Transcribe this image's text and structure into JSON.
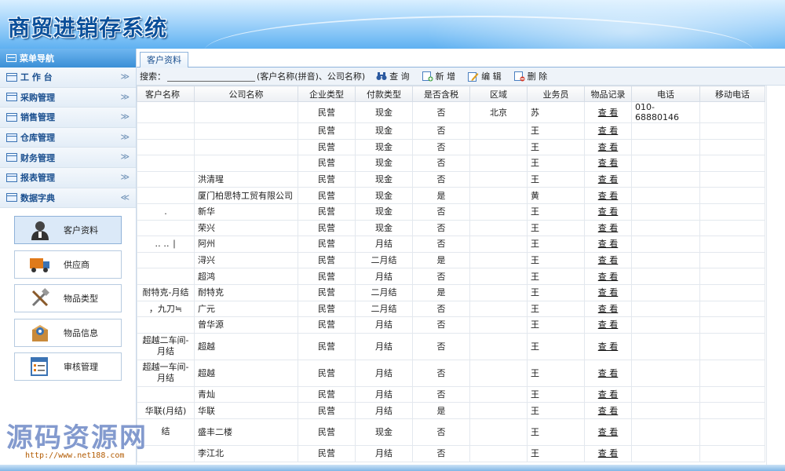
{
  "header": {
    "title": "商贸进销存系统"
  },
  "sidebar": {
    "heading": "菜单导航",
    "menu": [
      {
        "label": "工 作 台",
        "chev": "≫"
      },
      {
        "label": "采购管理",
        "chev": "≫"
      },
      {
        "label": "销售管理",
        "chev": "≫"
      },
      {
        "label": "仓库管理",
        "chev": "≫"
      },
      {
        "label": "财务管理",
        "chev": "≫"
      },
      {
        "label": "报表管理",
        "chev": "≫"
      },
      {
        "label": "数据字典",
        "chev": "≪"
      }
    ],
    "subitems": [
      {
        "label": "客户资料",
        "icon": "user-icon"
      },
      {
        "label": "供应商",
        "icon": "truck-icon"
      },
      {
        "label": "物品类型",
        "icon": "tools-icon"
      },
      {
        "label": "物品信息",
        "icon": "package-icon"
      },
      {
        "label": "审核管理",
        "icon": "form-icon"
      }
    ]
  },
  "tab": {
    "label": "客户资料"
  },
  "toolbar": {
    "search_label": "搜索：",
    "search_value": "",
    "hint": "(客户名称(拼音)、公司名称)",
    "query": "查 询",
    "add": "新 增",
    "edit": "编 辑",
    "delete": "删 除"
  },
  "columns": [
    "客户名称",
    "公司名称",
    "企业类型",
    "付款类型",
    "是否含税",
    "区域",
    "业务员",
    "物品记录",
    "电话",
    "移动电话"
  ],
  "rows": [
    [
      "",
      "",
      "民营",
      "现金",
      "否",
      "北京",
      "苏",
      "查 看",
      "010-68880146",
      ""
    ],
    [
      "",
      "",
      "民营",
      "现金",
      "否",
      "",
      "王",
      "查 看",
      "",
      ""
    ],
    [
      "",
      "",
      "民营",
      "现金",
      "否",
      "",
      "王",
      "查 看",
      "",
      ""
    ],
    [
      "",
      "",
      "民营",
      "现金",
      "否",
      "",
      "王",
      "查 看",
      "",
      ""
    ],
    [
      "",
      "洪清瑆",
      "民营",
      "现金",
      "否",
      "",
      "王",
      "查 看",
      "",
      ""
    ],
    [
      "",
      "厦门柏思特工贸有限公司",
      "民营",
      "现金",
      "是",
      "",
      "黄",
      "查 看",
      "",
      ""
    ],
    [
      ".",
      "新华",
      "民营",
      "现金",
      "否",
      "",
      "王",
      "查 看",
      "",
      ""
    ],
    [
      "",
      "荣兴",
      "民营",
      "现金",
      "否",
      "",
      "王",
      "查 看",
      "",
      ""
    ],
    [
      "‥ ‥ ∣",
      "阿州",
      "民营",
      "月结",
      "否",
      "",
      "王",
      "查 看",
      "",
      ""
    ],
    [
      "",
      "浔兴",
      "民营",
      "二月结",
      "是",
      "",
      "王",
      "查 看",
      "",
      ""
    ],
    [
      "",
      "超鸿",
      "民营",
      "月结",
      "否",
      "",
      "王",
      "查 看",
      "",
      ""
    ],
    [
      "耐特克-月结",
      "耐特克",
      "民营",
      "二月结",
      "是",
      "",
      "王",
      "查 看",
      "",
      ""
    ],
    [
      "，九刀≒",
      "广元",
      "民营",
      "二月结",
      "否",
      "",
      "王",
      "查 看",
      "",
      ""
    ],
    [
      "",
      "曾华源",
      "民营",
      "月结",
      "否",
      "",
      "王",
      "查 看",
      "",
      ""
    ],
    [
      "超越二车间-月结",
      "超越",
      "民营",
      "月结",
      "否",
      "",
      "王",
      "查 看",
      "",
      ""
    ],
    [
      "超越一车间-月结",
      "超越",
      "民营",
      "月结",
      "否",
      "",
      "王",
      "查 看",
      "",
      ""
    ],
    [
      "",
      "青灿",
      "民营",
      "月结",
      "否",
      "",
      "王",
      "查 看",
      "",
      ""
    ],
    [
      "华联(月结)",
      "华联",
      "民营",
      "月结",
      "是",
      "",
      "王",
      "查 看",
      "",
      ""
    ],
    [
      "结",
      "盛丰二楼",
      "民营",
      "现金",
      "否",
      "",
      "王",
      "查 看",
      "",
      ""
    ],
    [
      "",
      "李江北",
      "民营",
      "月结",
      "否",
      "",
      "王",
      "查 看",
      "",
      ""
    ]
  ],
  "tall_rows": [
    14,
    15,
    18
  ],
  "watermark": {
    "main": "源码资源网",
    "url": "http://www.net188.com"
  },
  "colors": {
    "accent": "#3a8fd6",
    "title": "#0a4f9a",
    "menu_text": "#1a4f8f"
  }
}
